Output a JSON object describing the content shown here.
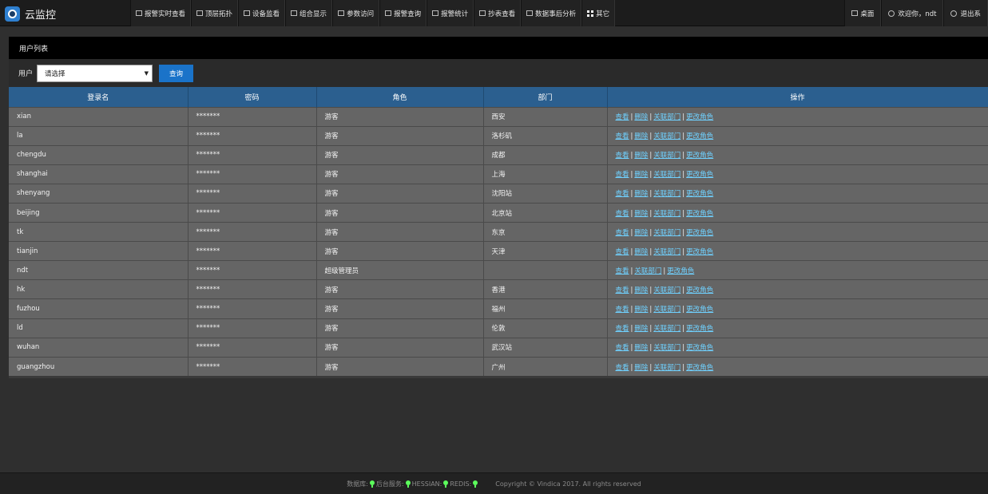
{
  "brand": {
    "title": "云监控",
    "logo_icon": "camera-eye-icon"
  },
  "nav": [
    {
      "label": "报警实时查看",
      "icon": "monitor-icon"
    },
    {
      "label": "顶层拓扑",
      "icon": "topology-icon"
    },
    {
      "label": "设备监看",
      "icon": "topology-icon"
    },
    {
      "label": "组合显示",
      "icon": "grid-icon"
    },
    {
      "label": "参数访问",
      "icon": "monitor-icon"
    },
    {
      "label": "报警查询",
      "icon": "speaker-icon"
    },
    {
      "label": "报警统计",
      "icon": "chart-icon"
    },
    {
      "label": "抄表查看",
      "icon": "table-icon"
    },
    {
      "label": "数据事后分析",
      "icon": "chart-icon"
    },
    {
      "label": "其它",
      "icon": "apps-grid-icon"
    }
  ],
  "nav_right": {
    "desktop": "桌面",
    "welcome": "欢迎你，ndt",
    "logout": "退出系"
  },
  "panel": {
    "title": "用户列表",
    "filter_label": "用户",
    "select_value": "请选择",
    "query_button": "查询"
  },
  "table": {
    "headers": [
      "登录名",
      "密码",
      "角色",
      "部门",
      "操作"
    ],
    "ops": {
      "view": "查看",
      "delete": "删除",
      "dept": "关联部门",
      "role": "更改角色"
    },
    "rows": [
      {
        "login": "xian",
        "password": "*******",
        "role": "游客",
        "dept": "西安",
        "deletable": true
      },
      {
        "login": "la",
        "password": "*******",
        "role": "游客",
        "dept": "洛杉矶",
        "deletable": true
      },
      {
        "login": "chengdu",
        "password": "*******",
        "role": "游客",
        "dept": "成都",
        "deletable": true
      },
      {
        "login": "shanghai",
        "password": "*******",
        "role": "游客",
        "dept": "上海",
        "deletable": true
      },
      {
        "login": "shenyang",
        "password": "*******",
        "role": "游客",
        "dept": "沈阳站",
        "deletable": true
      },
      {
        "login": "beijing",
        "password": "*******",
        "role": "游客",
        "dept": "北京站",
        "deletable": true
      },
      {
        "login": "tk",
        "password": "*******",
        "role": "游客",
        "dept": "东京",
        "deletable": true
      },
      {
        "login": "tianjin",
        "password": "*******",
        "role": "游客",
        "dept": "天津",
        "deletable": true
      },
      {
        "login": "ndt",
        "password": "*******",
        "role": "超级管理员",
        "dept": "",
        "deletable": false
      },
      {
        "login": "hk",
        "password": "*******",
        "role": "游客",
        "dept": "香港",
        "deletable": true
      },
      {
        "login": "fuzhou",
        "password": "*******",
        "role": "游客",
        "dept": "福州",
        "deletable": true
      },
      {
        "login": "ld",
        "password": "*******",
        "role": "游客",
        "dept": "伦敦",
        "deletable": true
      },
      {
        "login": "wuhan",
        "password": "*******",
        "role": "游客",
        "dept": "武汉站",
        "deletable": true
      },
      {
        "login": "guangzhou",
        "password": "*******",
        "role": "游客",
        "dept": "广州",
        "deletable": true
      }
    ]
  },
  "footer": {
    "db_label": "数据库:",
    "backend_label": "后台服务:",
    "hessian_label": "HESSIAN:",
    "redis_label": "REDIS:",
    "copyright": "Copyright © Vindica 2017. All rights reserved",
    "status_color": "#5cff5c"
  }
}
